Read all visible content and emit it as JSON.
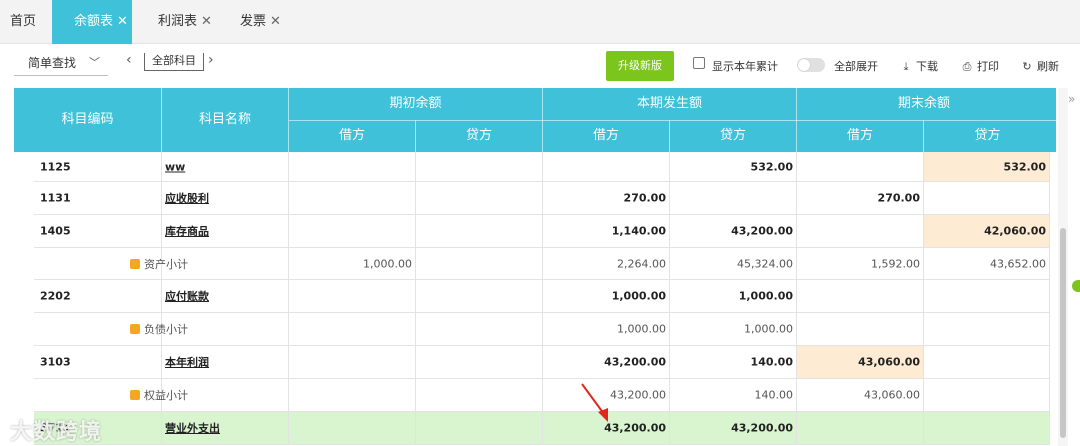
{
  "tabs": [
    {
      "label": "首页",
      "closable": false,
      "active": false
    },
    {
      "label": "余额表",
      "closable": true,
      "active": true
    },
    {
      "label": "利润表",
      "closable": true,
      "active": false
    },
    {
      "label": "发票",
      "closable": true,
      "active": false
    }
  ],
  "toolbar": {
    "search_mode": "简单查找",
    "scope": "全部科目",
    "upgrade_label": "升级新版",
    "show_year_label": "显示本年累计",
    "expand_label": "全部展开",
    "download_label": "下载",
    "print_label": "打印",
    "refresh_label": "刷新"
  },
  "table": {
    "col_code": "科目编码",
    "col_name": "科目名称",
    "group_open": "期初余额",
    "group_period": "本期发生额",
    "group_close": "期末余额",
    "debit": "借方",
    "credit": "贷方",
    "rows": [
      {
        "type": "account",
        "code": "1125",
        "name": "ww",
        "open_d": "",
        "open_c": "",
        "per_d": "",
        "per_c": "532.00",
        "close_d": "",
        "close_c": "532.00"
      },
      {
        "type": "account",
        "code": "1131",
        "name": "应收股利",
        "open_d": "",
        "open_c": "",
        "per_d": "270.00",
        "per_c": "",
        "close_d": "270.00",
        "close_c": ""
      },
      {
        "type": "account",
        "code": "1405",
        "name": "库存商品",
        "open_d": "",
        "open_c": "",
        "per_d": "1,140.00",
        "per_c": "43,200.00",
        "close_d": "",
        "close_c": "42,060.00"
      },
      {
        "type": "subtotal",
        "code": "",
        "name": "资产小计",
        "open_d": "1,000.00",
        "open_c": "",
        "per_d": "2,264.00",
        "per_c": "45,324.00",
        "close_d": "1,592.00",
        "close_c": "43,652.00"
      },
      {
        "type": "account",
        "code": "2202",
        "name": "应付账款",
        "open_d": "",
        "open_c": "",
        "per_d": "1,000.00",
        "per_c": "1,000.00",
        "close_d": "",
        "close_c": ""
      },
      {
        "type": "subtotal",
        "code": "",
        "name": "负债小计",
        "open_d": "",
        "open_c": "",
        "per_d": "1,000.00",
        "per_c": "1,000.00",
        "close_d": "",
        "close_c": ""
      },
      {
        "type": "account",
        "code": "3103",
        "name": "本年利润",
        "open_d": "",
        "open_c": "",
        "per_d": "43,200.00",
        "per_c": "140.00",
        "close_d": "43,060.00",
        "close_c": ""
      },
      {
        "type": "subtotal",
        "code": "",
        "name": "权益小计",
        "open_d": "",
        "open_c": "",
        "per_d": "43,200.00",
        "per_c": "140.00",
        "close_d": "43,060.00",
        "close_c": ""
      },
      {
        "type": "account",
        "code": "5711",
        "name": "营业外支出",
        "open_d": "",
        "open_c": "",
        "per_d": "43,200.00",
        "per_c": "43,200.00",
        "close_d": "",
        "close_c": ""
      }
    ]
  },
  "watermark": "大数跨境",
  "colors": {
    "accent": "#3ec1d9",
    "upgrade": "#7cc51d",
    "highlight": "#fdebd4",
    "green_row": "#d9f5cf"
  }
}
